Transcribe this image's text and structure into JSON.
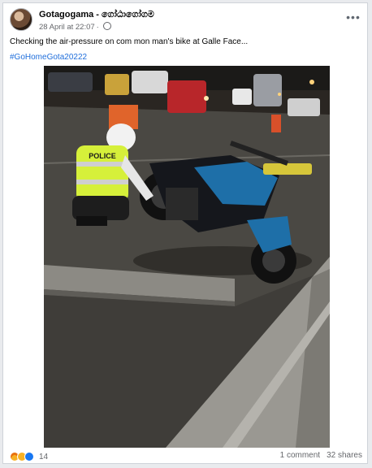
{
  "post": {
    "author": "Gotagogama - ගෝඨාගෝගම",
    "timestamp": "28 April at 22:07",
    "separator": "·",
    "caption": "Checking the air-pressure on com mon man's bike at Galle Face...",
    "hashtag": "#GoHomeGota20222",
    "photo_text": "POLICE"
  },
  "engagement": {
    "reaction_count": "14",
    "comments": "1 comment",
    "shares": "32 shares",
    "reactions": [
      "angry-icon",
      "sad-icon",
      "like-icon"
    ]
  },
  "colors": {
    "link": "#216fdb",
    "secondary_text": "#65676b",
    "vest": "#d6f03a",
    "bike_blue": "#1e6fa8"
  }
}
